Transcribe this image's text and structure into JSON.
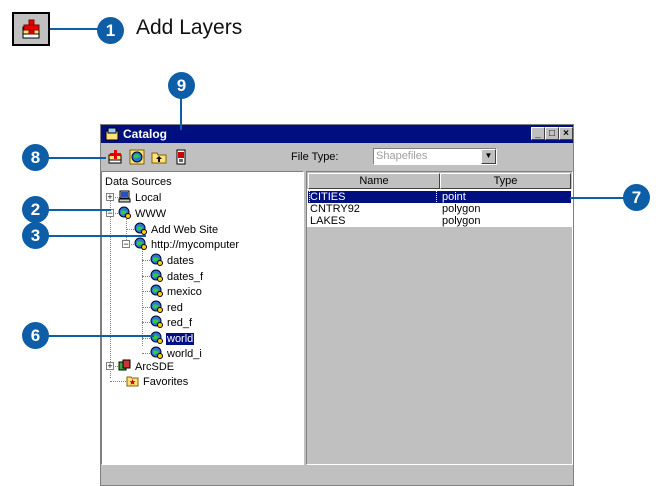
{
  "caption": "Add Layers",
  "callouts": [
    "1",
    "2",
    "3",
    "6",
    "7",
    "8",
    "9"
  ],
  "window": {
    "title": "Catalog",
    "buttons": [
      "_",
      "□",
      "×"
    ],
    "file_type_label": "File Type:",
    "file_type_value": "Shapefiles"
  },
  "tree": {
    "root": "Data Sources",
    "local": "Local",
    "www": "WWW",
    "add_web_site": "Add Web Site",
    "server": "http://mycomputer",
    "services": [
      "dates",
      "dates_f",
      "mexico",
      "red",
      "red_f",
      "world",
      "world_i"
    ],
    "selected": "world",
    "arcsde": "ArcSDE",
    "favorites": "Favorites"
  },
  "list": {
    "columns": [
      "Name",
      "Type"
    ],
    "rows": [
      {
        "name": "CITIES",
        "type": "point"
      },
      {
        "name": "CNTRY92",
        "type": "polygon"
      },
      {
        "name": "LAKES",
        "type": "polygon"
      }
    ]
  },
  "colors": {
    "callout": "#0d5ea6",
    "selection": "#000f80",
    "chrome": "#c0c0c0"
  }
}
